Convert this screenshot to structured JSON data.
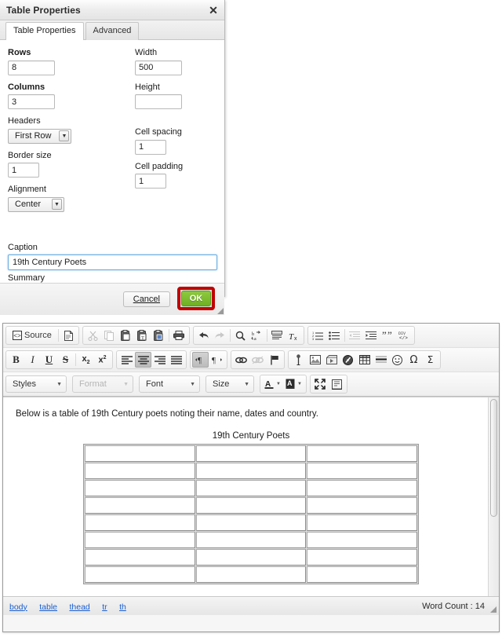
{
  "dialog": {
    "title": "Table Properties",
    "close_icon": "close-icon",
    "tabs": [
      {
        "label": "Table Properties",
        "active": true
      },
      {
        "label": "Advanced",
        "active": false
      }
    ],
    "fields": {
      "rows_label": "Rows",
      "rows_value": "8",
      "columns_label": "Columns",
      "columns_value": "3",
      "headers_label": "Headers",
      "headers_value": "First Row",
      "border_label": "Border size",
      "border_value": "1",
      "alignment_label": "Alignment",
      "alignment_value": "Center",
      "width_label": "Width",
      "width_value": "500",
      "height_label": "Height",
      "height_value": "",
      "cell_spacing_label": "Cell spacing",
      "cell_spacing_value": "1",
      "cell_padding_label": "Cell padding",
      "cell_padding_value": "1",
      "caption_label": "Caption",
      "caption_value": "19th Century Poets",
      "summary_label": "Summary",
      "summary_value": ""
    },
    "footer": {
      "cancel_label": "Cancel",
      "ok_label": "OK",
      "ok_highlight_color": "#c00000",
      "ok_button_color": "#7cbd31"
    }
  },
  "editor": {
    "toolbar_row1": {
      "group_document": [
        {
          "name": "source-button",
          "label": "Source",
          "icon": "source-code-icon"
        },
        {
          "name": "new-page-button",
          "label": "",
          "icon": "new-page-icon"
        }
      ],
      "group_clipboard": [
        {
          "name": "cut-button",
          "icon": "scissors-icon",
          "disabled": true
        },
        {
          "name": "copy-button",
          "icon": "copy-icon",
          "disabled": true
        },
        {
          "name": "paste-button",
          "icon": "paste-icon",
          "disabled": false
        },
        {
          "name": "paste-text-button",
          "icon": "paste-text-icon",
          "disabled": false
        },
        {
          "name": "paste-word-button",
          "icon": "paste-word-icon",
          "disabled": false
        },
        {
          "name": "print-button",
          "icon": "printer-icon",
          "disabled": false
        }
      ],
      "group_undo": [
        {
          "name": "undo-button",
          "icon": "undo-arrow-icon",
          "disabled": false
        },
        {
          "name": "redo-button",
          "icon": "redo-arrow-icon",
          "disabled": true
        },
        {
          "name": "find-button",
          "icon": "magnifier-icon",
          "disabled": false
        },
        {
          "name": "replace-button",
          "icon": "replace-icon",
          "disabled": false
        },
        {
          "name": "select-all-button",
          "icon": "select-all-icon",
          "disabled": false
        },
        {
          "name": "remove-format-button",
          "icon": "remove-format-icon",
          "disabled": false
        }
      ],
      "group_lists": [
        {
          "name": "numbered-list-button",
          "icon": "numbered-list-icon",
          "disabled": false
        },
        {
          "name": "bulleted-list-button",
          "icon": "bulleted-list-icon",
          "disabled": false
        },
        {
          "name": "decrease-indent-button",
          "icon": "outdent-icon",
          "disabled": true
        },
        {
          "name": "increase-indent-button",
          "icon": "indent-icon",
          "disabled": false
        },
        {
          "name": "blockquote-button",
          "icon": "blockquote-icon",
          "disabled": false
        },
        {
          "name": "div-container-button",
          "icon": "div-container-icon",
          "disabled": false
        }
      ]
    },
    "toolbar_row2": {
      "group_basic": [
        {
          "name": "bold-button",
          "label": "B",
          "icon": "bold-icon"
        },
        {
          "name": "italic-button",
          "label": "I",
          "icon": "italic-icon"
        },
        {
          "name": "underline-button",
          "label": "U",
          "icon": "underline-icon"
        },
        {
          "name": "strike-button",
          "label": "S",
          "icon": "strikethrough-icon"
        },
        {
          "name": "subscript-button",
          "label": "x",
          "icon": "subscript-icon"
        },
        {
          "name": "superscript-button",
          "label": "x",
          "icon": "superscript-icon"
        }
      ],
      "group_align": [
        {
          "name": "align-left-button",
          "icon": "align-left-icon",
          "active": false
        },
        {
          "name": "align-center-button",
          "icon": "align-center-icon",
          "active": true
        },
        {
          "name": "align-right-button",
          "icon": "align-right-icon",
          "active": false
        },
        {
          "name": "align-justify-button",
          "icon": "align-justify-icon",
          "active": false
        }
      ],
      "group_direction": [
        {
          "name": "text-direction-ltr-button",
          "icon": "ltr-icon",
          "active": true
        },
        {
          "name": "text-direction-rtl-button",
          "icon": "rtl-icon",
          "active": false
        }
      ],
      "group_link": [
        {
          "name": "link-button",
          "icon": "link-icon",
          "disabled": false
        },
        {
          "name": "unlink-button",
          "icon": "unlink-icon",
          "disabled": true
        },
        {
          "name": "anchor-button",
          "icon": "flag-anchor-icon",
          "disabled": false
        }
      ],
      "group_insert": [
        {
          "name": "insert-pin-button",
          "icon": "pin-icon"
        },
        {
          "name": "insert-image-button",
          "icon": "image-icon"
        },
        {
          "name": "insert-flash-button",
          "icon": "flash-icon"
        },
        {
          "name": "insert-media-button",
          "icon": "media-icon"
        },
        {
          "name": "insert-table-button",
          "icon": "table-grid-icon"
        },
        {
          "name": "insert-hr-button",
          "icon": "horizontal-rule-icon"
        },
        {
          "name": "insert-smiley-button",
          "icon": "smiley-icon"
        },
        {
          "name": "insert-special-char-button",
          "icon": "omega-icon"
        },
        {
          "name": "insert-math-button",
          "icon": "sigma-icon"
        }
      ]
    },
    "toolbar_row3": {
      "combos": [
        {
          "name": "styles-combo",
          "label": "Styles",
          "disabled": false
        },
        {
          "name": "format-combo",
          "label": "Format",
          "disabled": true
        },
        {
          "name": "font-combo",
          "label": "Font",
          "disabled": false
        },
        {
          "name": "size-combo",
          "label": "Size",
          "disabled": false
        }
      ],
      "color_buttons": [
        {
          "name": "text-color-button",
          "label": "A",
          "icon": "text-color-icon"
        },
        {
          "name": "background-color-button",
          "label": "A",
          "icon": "bg-color-icon"
        }
      ],
      "tools": [
        {
          "name": "maximize-button",
          "icon": "maximize-icon"
        },
        {
          "name": "show-blocks-button",
          "icon": "show-blocks-icon"
        }
      ]
    },
    "content": {
      "paragraph": "Below is a table of 19th Century poets noting their name, dates and country.",
      "table_caption": "19th Century Poets",
      "table_rows": 8,
      "table_columns": 3,
      "table_cells": [
        [
          "",
          "",
          ""
        ],
        [
          "",
          "",
          ""
        ],
        [
          "",
          "",
          ""
        ],
        [
          "",
          "",
          ""
        ],
        [
          "",
          "",
          ""
        ],
        [
          "",
          "",
          ""
        ],
        [
          "",
          "",
          ""
        ],
        [
          "",
          "",
          ""
        ]
      ]
    },
    "status": {
      "element_path": [
        "body",
        "table",
        "thead",
        "tr",
        "th"
      ],
      "word_count": "Word Count : 14"
    }
  }
}
